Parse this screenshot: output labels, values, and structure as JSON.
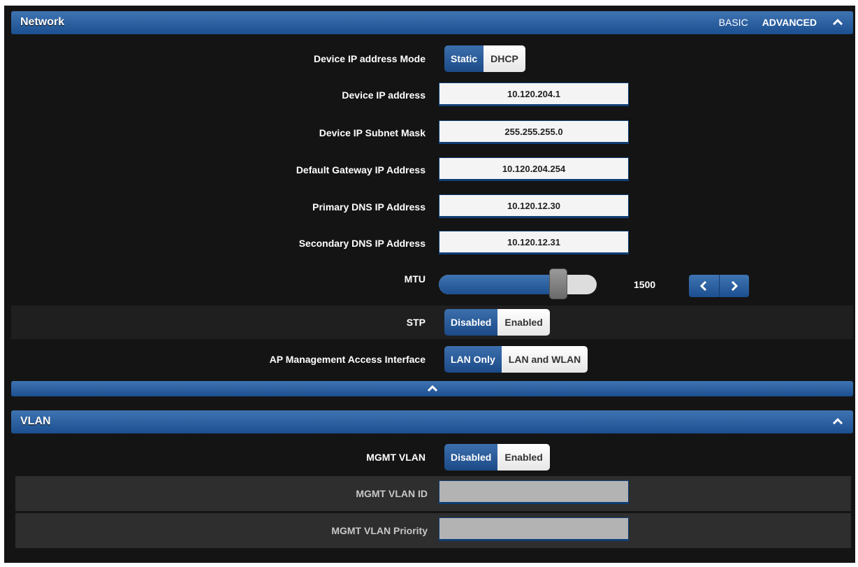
{
  "network": {
    "title": "Network",
    "view_basic": "BASIC",
    "view_advanced": "ADVANCED",
    "ip_mode": {
      "label": "Device IP address Mode",
      "opt_static": "Static",
      "opt_dhcp": "DHCP",
      "selected": "Static"
    },
    "ip_address": {
      "label": "Device IP address",
      "value": "10.120.204.1"
    },
    "subnet_mask": {
      "label": "Device IP Subnet Mask",
      "value": "255.255.255.0"
    },
    "gateway": {
      "label": "Default Gateway IP Address",
      "value": "10.120.204.254"
    },
    "primary_dns": {
      "label": "Primary DNS IP Address",
      "value": "10.120.12.30"
    },
    "secondary_dns": {
      "label": "Secondary DNS IP Address",
      "value": "10.120.12.31"
    },
    "mtu": {
      "label": "MTU",
      "value": "1500",
      "level": 0.75
    },
    "stp": {
      "label": "STP",
      "opt_disabled": "Disabled",
      "opt_enabled": "Enabled",
      "selected": "Disabled"
    },
    "mgmt_access": {
      "label": "AP Management Access Interface",
      "opt_lan": "LAN Only",
      "opt_lan_wlan": "LAN and WLAN",
      "selected": "LAN Only"
    }
  },
  "vlan": {
    "title": "VLAN",
    "mgmt_vlan": {
      "label": "MGMT VLAN",
      "opt_disabled": "Disabled",
      "opt_enabled": "Enabled",
      "selected": "Disabled"
    },
    "mgmt_vlan_id": {
      "label": "MGMT VLAN ID",
      "value": ""
    },
    "mgmt_vlan_priority": {
      "label": "MGMT VLAN Priority",
      "value": ""
    }
  },
  "icons": {
    "collapse": "chevron-up-icon",
    "prev": "chevron-left-icon",
    "next": "chevron-right-icon"
  },
  "colors": {
    "accent": "#2a5e9f",
    "background": "#141414"
  }
}
